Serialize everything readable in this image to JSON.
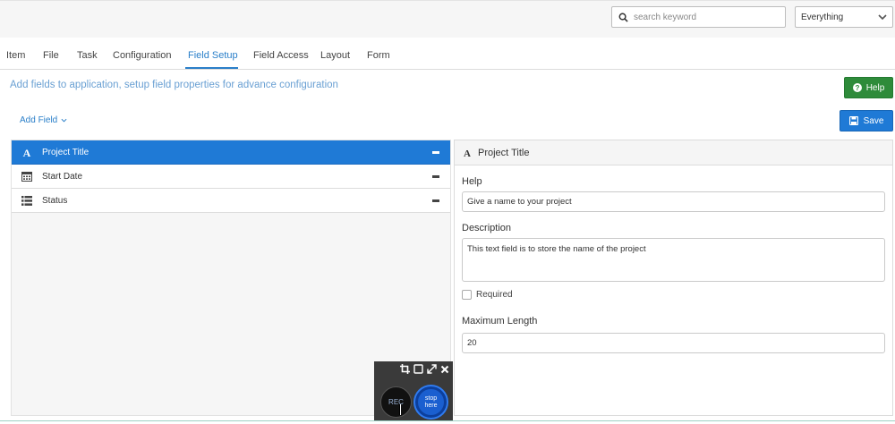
{
  "search": {
    "placeholder": "search keyword"
  },
  "scope_select": {
    "value": "Everything"
  },
  "tabs": [
    {
      "label": "Item"
    },
    {
      "label": "File"
    },
    {
      "label": "Task"
    },
    {
      "label": "Configuration"
    },
    {
      "label": "Field Setup",
      "active": true
    },
    {
      "label": "Field Access"
    },
    {
      "label": "Layout"
    },
    {
      "label": "Form"
    }
  ],
  "subtitle": "Add fields to application, setup field properties for advance configuration",
  "help_button": {
    "label": "Help"
  },
  "add_field": {
    "label": "Add Field"
  },
  "save_button": {
    "label": "Save"
  },
  "fields": [
    {
      "label": "Project Title",
      "icon": "text-type-icon",
      "selected": true
    },
    {
      "label": "Start Date",
      "icon": "calendar-icon",
      "selected": false
    },
    {
      "label": "Status",
      "icon": "list-icon",
      "selected": false
    }
  ],
  "properties": {
    "title": "Project Title",
    "help_label": "Help",
    "help_value": "Give a name to your project",
    "description_label": "Description",
    "description_value": "This text field is to store the name of the project",
    "required_label": "Required",
    "required_checked": false,
    "max_length_label": "Maximum Length",
    "max_length_value": "20"
  },
  "recorder": {
    "rec_label": "REC",
    "stop_label": "stop here"
  },
  "colors": {
    "accent": "#1f7ad6",
    "help_green": "#2e8b3a",
    "subtitle": "#6aa0d3"
  }
}
